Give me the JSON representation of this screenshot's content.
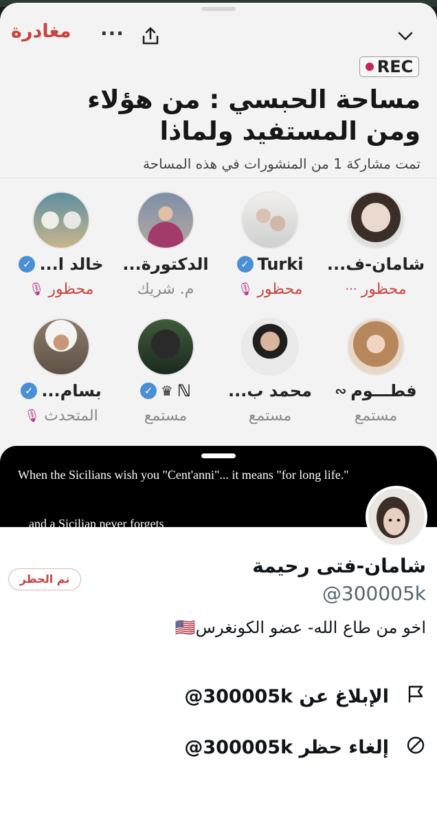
{
  "space": {
    "leave_label": "مغادرة",
    "rec_label": "REC",
    "title": "مساحة الحبسي : من هؤلاء ومن المستفيد ولماذا",
    "subtitle": "تمت مشاركة 1 من المنشورات في هذه المساحة",
    "colors": {
      "accent_red": "#c9443e",
      "verified_blue": "#4a8fd3",
      "rec_dot": "#c7245a"
    },
    "participants": [
      {
        "name": "شامان-ف...",
        "role": "محظور",
        "verified": false,
        "muted": true,
        "extra": "···"
      },
      {
        "name": "Turki",
        "role": "محظور",
        "verified": true,
        "muted": true
      },
      {
        "name": "الدكتورة...",
        "role": "م. شريك",
        "verified": false,
        "muted": false
      },
      {
        "name": "خالد ا...",
        "role": "محظور",
        "verified": true,
        "muted": true
      },
      {
        "name": "فطـــوم",
        "role": "مستمع",
        "verified": false,
        "muted": false
      },
      {
        "name": "محمد ب...",
        "role": "مستمع",
        "verified": false,
        "muted": false
      },
      {
        "name": "ℕ",
        "role": "مستمع",
        "verified": true,
        "muted": false,
        "crown": "♛"
      },
      {
        "name": "بسام...",
        "role": "المتحدث",
        "verified": true,
        "muted": true
      }
    ]
  },
  "caption": {
    "line1": "When the Sicilians wish you \"Cent'anni\"...  it means \"for long life.\"",
    "line2": "and a Sicilian never forgets"
  },
  "profile": {
    "name": "شامان-فتى رحيمة",
    "handle": "@300005k",
    "blocked_label": "تم الحظر",
    "bio": "اخو من طاع الله- عضو الكونغرس🇺🇸",
    "actions": [
      {
        "icon": "flag-icon",
        "label": "الإبلاغ عن 300005k@"
      },
      {
        "icon": "unblock-icon",
        "label": "إلغاء حظر 300005k@"
      }
    ]
  }
}
